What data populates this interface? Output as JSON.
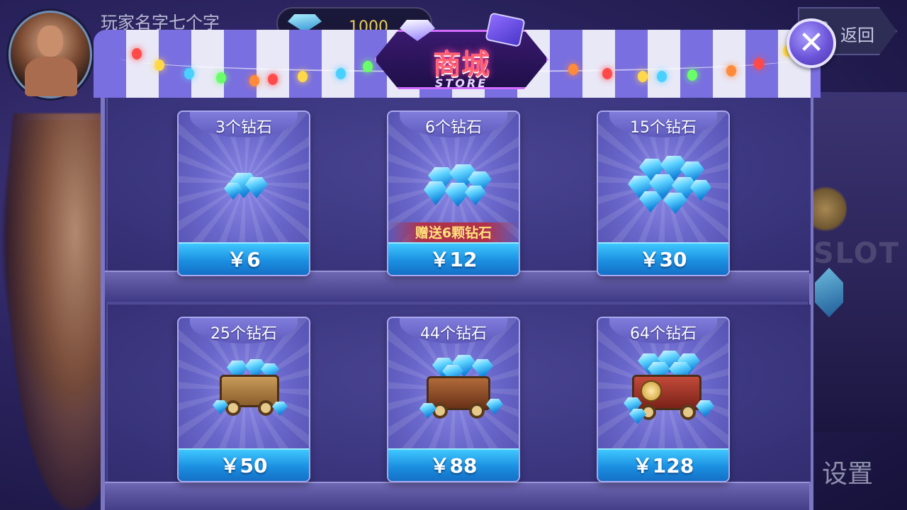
{
  "header": {
    "player_name": "玩家名字七个字",
    "currency_value": "1000",
    "back_label": "返回"
  },
  "store": {
    "title": "商城",
    "subtitle": "STORE",
    "close_icon": "close-icon"
  },
  "footer": {
    "settings_label": "设置"
  },
  "background": {
    "slot_text": "SLOT"
  },
  "products": [
    {
      "title": "3个钻石",
      "price": "￥6",
      "promo": "",
      "art": "gem-small"
    },
    {
      "title": "6个钻石",
      "price": "￥12",
      "promo": "赠送6颗钻石",
      "art": "gem-pile"
    },
    {
      "title": "15个钻石",
      "price": "￥30",
      "promo": "",
      "art": "gem-large-pile"
    },
    {
      "title": "25个钻石",
      "price": "￥50",
      "promo": "",
      "art": "cart-wood"
    },
    {
      "title": "44个钻石",
      "price": "￥88",
      "promo": "",
      "art": "cart-brown"
    },
    {
      "title": "64个钻石",
      "price": "￥128",
      "promo": "",
      "art": "cart-red"
    }
  ],
  "colors": {
    "accent_blue": "#1b8fe0",
    "promo_text": "#ffe27a",
    "awning_purple": "#7a6fe0",
    "card_purple": "#6a67cb"
  }
}
